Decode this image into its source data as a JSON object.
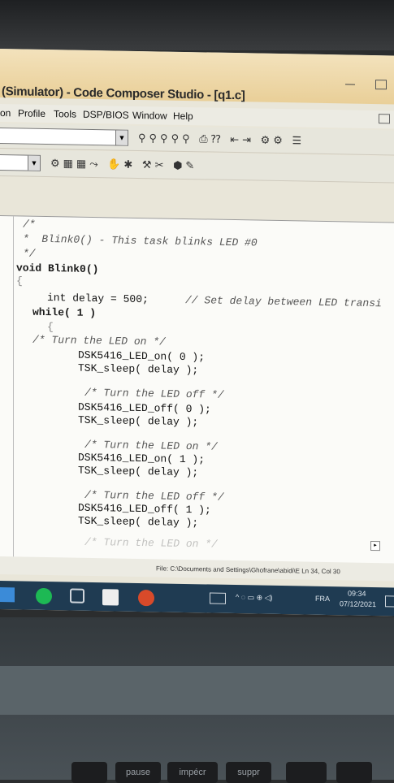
{
  "window": {
    "title": "(Simulator) - Code Composer Studio - [q1.c]"
  },
  "menu": {
    "items": [
      "on",
      "Profile",
      "Tools",
      "DSP/BIOS",
      "Window",
      "Help"
    ]
  },
  "toolbar": {
    "icons": [
      "find-icon",
      "find-next-icon",
      "find-prev-icon",
      "replace-icon",
      "bookmark-icon",
      "print-icon",
      "help-icon",
      "indent-icon",
      "outdent-icon",
      "build-icon",
      "rebuild-icon",
      "stop-icon",
      "breakpoint-icon",
      "hand-icon",
      "step-icon",
      "run-icon",
      "halt-icon"
    ]
  },
  "code": {
    "header_comment": "*  Blink0() - This task blinks LED #0",
    "comment_open": "/*",
    "comment_close": "*/",
    "func_sig": "void Blink0()",
    "brace_open": "{",
    "decl": "int delay = 500;",
    "decl_comment": "// Set delay between LED transi",
    "while_stmt": "while( 1 )",
    "while_brace": "{",
    "c1": "/* Turn the LED on */",
    "l1": "DSK5416_LED_on( 0 );",
    "s1": "TSK_sleep( delay );",
    "c2": "/* Turn the LED off */",
    "l2": "DSK5416_LED_off( 0 );",
    "s2": "TSK_sleep( delay );",
    "c3": "/* Turn the LED on */",
    "l3": "DSK5416_LED_on( 1 );",
    "s3": "TSK_sleep( delay );",
    "c4": "/* Turn the LED off */",
    "l4": "DSK5416_LED_off( 1 );",
    "s4": "TSK_sleep( delay );",
    "c5": "/* Turn the LED on */"
  },
  "status": {
    "text": "File: C:\\Documents and Settings\\Ghofrane\\abidi\\E  Ln 34, Col 30"
  },
  "taskbar": {
    "lang": "FRA",
    "time": "09:34",
    "date": "07/12/2021"
  },
  "keyboard": {
    "keys": [
      "pause",
      "impécr",
      "suppr"
    ]
  }
}
